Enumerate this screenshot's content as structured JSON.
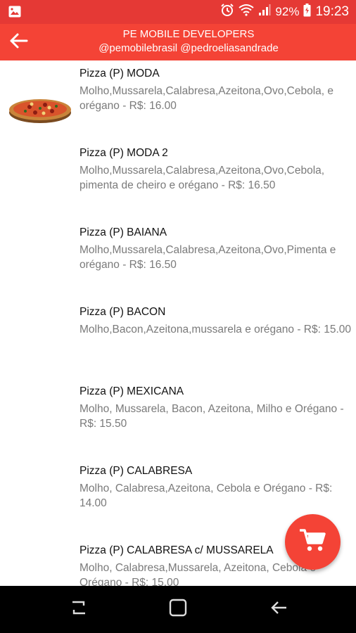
{
  "status_bar": {
    "battery_percent": "92%",
    "time": "19:23",
    "icons": [
      "gallery-icon",
      "alarm-icon",
      "wifi-icon",
      "signal-icon",
      "battery-icon"
    ]
  },
  "app_bar": {
    "title": "PE MOBILE DEVELOPERS",
    "subtitle": "@pemobilebrasil @pedroeliasandrade",
    "back_icon": "arrow-left-icon",
    "color": "#f44336"
  },
  "menu_items": [
    {
      "name": "Pizza (P) MODA",
      "description": "Molho,Mussarela,Calabresa,Azeitona,Ovo,Cebola, e orégano  - R$: 16.00"
    },
    {
      "name": "Pizza (P) MODA 2",
      "description": "Molho,Mussarela,Calabresa,Azeitona,Ovo,Cebola, pimenta de cheiro e orégano  - R$: 16.50"
    },
    {
      "name": "Pizza (P) BAIANA",
      "description": "Molho,Mussarela,Calabresa,Azeitona,Ovo,Pimenta e orégano  - R$: 16.50"
    },
    {
      "name": "Pizza (P) BACON",
      "description": "Molho,Bacon,Azeitona,mussarela e orégano  - R$: 15.00"
    },
    {
      "name": "Pizza (P) MEXICANA",
      "description": "Molho, Mussarela, Bacon, Azeitona, Milho e Orégano  - R$: 15.50"
    },
    {
      "name": "Pizza (P) CALABRESA",
      "description": "Molho, Calabresa,Azeitona, Cebola e Orégano  - R$: 14.00"
    },
    {
      "name": "Pizza (P) CALABRESA c/ MUSSARELA",
      "description": "Molho, Calabresa,Mussarela, Azeitona, Cebola e Orégano  - R$: 15.00"
    }
  ],
  "fab": {
    "icon": "cart-icon",
    "color": "#f44336"
  },
  "nav_bar": {
    "icons": [
      "recent-apps-icon",
      "home-icon",
      "back-icon"
    ]
  }
}
